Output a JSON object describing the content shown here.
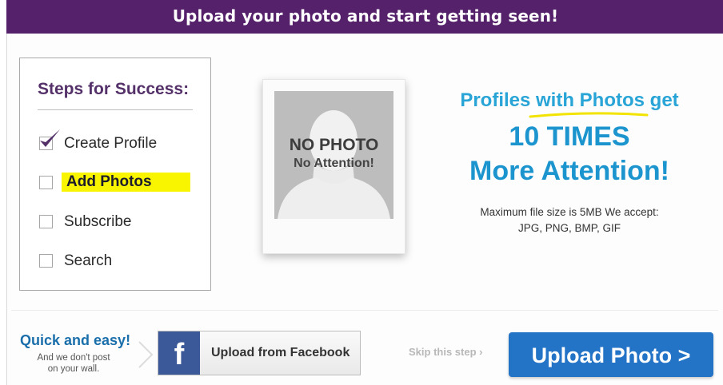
{
  "header": {
    "title": "Upload your photo and start getting seen!"
  },
  "steps": {
    "title": "Steps for Success:",
    "items": [
      {
        "label": "Create Profile",
        "checked": true
      },
      {
        "label": "Add Photos",
        "checked": false,
        "highlighted": true
      },
      {
        "label": "Subscribe",
        "checked": false
      },
      {
        "label": "Search",
        "checked": false
      }
    ]
  },
  "placeholder": {
    "line1": "NO PHOTO",
    "line2": "No Attention!"
  },
  "promo": {
    "line1_a": "Profiles ",
    "line1_b": "with Photos",
    "line1_c": " get",
    "line2": "10 TIMES",
    "line3": "More Attention!"
  },
  "file_info": {
    "line1": "Maximum file size is 5MB We accept:",
    "line2": "JPG, PNG, BMP, GIF"
  },
  "footer": {
    "quick_title": "Quick and easy!",
    "quick_sub1": "And we don't post",
    "quick_sub2": "on your wall.",
    "facebook_icon_glyph": "f",
    "facebook_button": "Upload from Facebook",
    "skip": "Skip this step ›",
    "upload_button": "Upload Photo >"
  },
  "colors": {
    "header_bg": "#56216b",
    "accent_blue": "#1c95cf",
    "facebook_blue": "#3b5998",
    "upload_blue": "#2373c6",
    "highlight": "#f9f400",
    "check_purple": "#55316a"
  },
  "icons": [
    "checkmark-icon",
    "facebook-icon",
    "avatar-silhouette-icon"
  ]
}
